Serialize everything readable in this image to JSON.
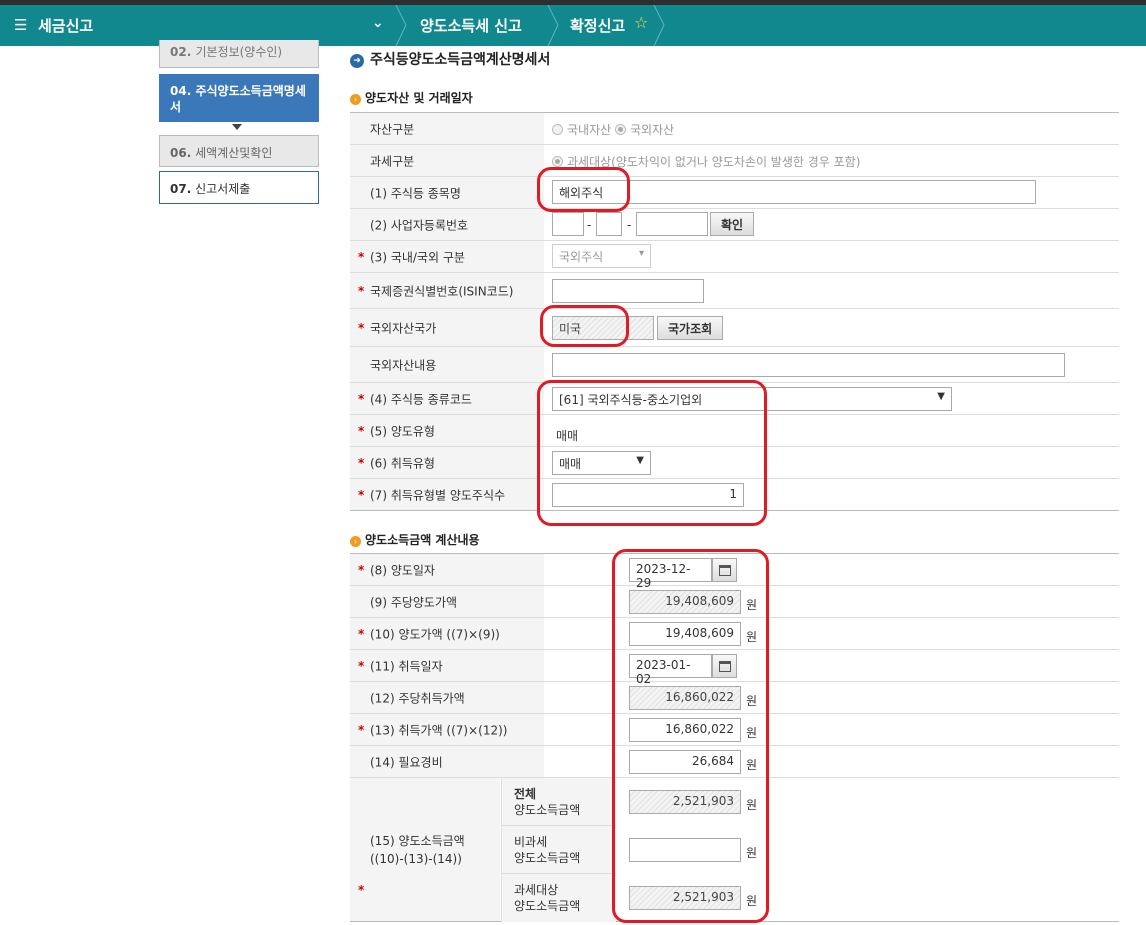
{
  "header": {
    "menu_icon": "hamburger-icon",
    "title": "세금신고",
    "crumbs": [
      "양도소득세 신고",
      "확정신고"
    ]
  },
  "sidebar": {
    "items": [
      {
        "num": "02.",
        "label": "기본정보(양수인)"
      },
      {
        "num": "04.",
        "label": "주식양도소득금액명세서"
      },
      {
        "num": "06.",
        "label": "세액계산및확인"
      },
      {
        "num": "07.",
        "label": "신고서제출"
      }
    ]
  },
  "page_title": "주식등양도소득금액계산명세서",
  "section1": {
    "title": "양도자산 및 거래일자",
    "rows": {
      "asset_type": {
        "label": "자산구분",
        "opt1": "국내자산",
        "opt2": "국외자산"
      },
      "tax_type": {
        "label": "과세구분",
        "opt": "과세대상(양도차익이 없거나 양도차손이 발생한 경우 포함)"
      },
      "stock_name": {
        "label": "(1) 주식등 종목명",
        "value": "해외주식"
      },
      "bizno": {
        "label": "(2) 사업자등록번호",
        "dash": "-",
        "button": "확인"
      },
      "domestic": {
        "label": "(3) 국내/국외 구분",
        "value": "국외주식"
      },
      "isin": {
        "label": "국제증권식별번호(ISIN코드)",
        "value": ""
      },
      "country": {
        "label": "국외자산국가",
        "value": "미국",
        "button": "국가조회"
      },
      "content": {
        "label": "국외자산내용",
        "value": ""
      },
      "kind": {
        "label": "(4) 주식등 종류코드",
        "value": "[61] 국외주식등-중소기업외"
      },
      "transfer_type": {
        "label": "(5) 양도유형",
        "value": "매매"
      },
      "acq_type": {
        "label": "(6) 취득유형",
        "value": "매매"
      },
      "qty": {
        "label": "(7) 취득유형별 양도주식수",
        "value": "1"
      }
    }
  },
  "section2": {
    "title": "양도소득금액 계산내용",
    "unit": "원",
    "rows": {
      "r8": {
        "label": "(8) 양도일자",
        "value": "2023-12-29"
      },
      "r9": {
        "label": "(9) 주당양도가액",
        "value": "19,408,609"
      },
      "r10": {
        "label": "(10) 양도가액 ((7)×(9))",
        "value": "19,408,609"
      },
      "r11": {
        "label": "(11) 취득일자",
        "value": "2023-01-02"
      },
      "r12": {
        "label": "(12) 주당취득가액",
        "value": "16,860,022"
      },
      "r13": {
        "label": "(13) 취득가액 ((7)×(12))",
        "value": "16,860,022"
      },
      "r14": {
        "label": "(14) 필요경비",
        "value": "26,684"
      },
      "r15": {
        "label1": "(15) 양도소득금액",
        "label2": "((10)-(13)-(14))",
        "total_label1": "전체",
        "total_label2": "양도소득금액",
        "total": "2,521,903",
        "nontax_label1": "비과세",
        "nontax_label2": "양도소득금액",
        "nontax": "",
        "taxable_label1": "과세대상",
        "taxable_label2": "양도소득금액",
        "taxable": "2,521,903"
      }
    }
  },
  "colors": {
    "header": "#10888e",
    "active": "#3b78b9",
    "required": "#c00000",
    "highlight": "#e01b24"
  }
}
